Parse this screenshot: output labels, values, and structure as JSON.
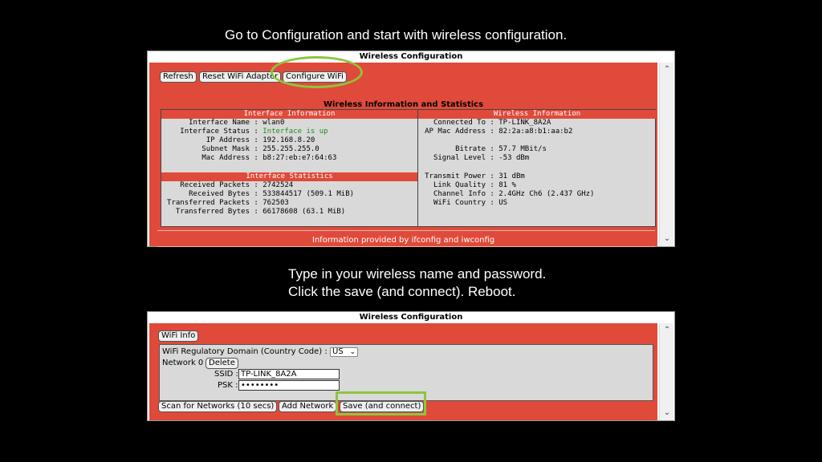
{
  "captions": {
    "top": "Go to Configuration and start with wireless configuration.",
    "mid_line1": "Type in your wireless name and password.",
    "mid_line2": "Click the save (and connect). Reboot."
  },
  "top_panel": {
    "title": "Wireless Configuration",
    "buttons": {
      "refresh": "Refresh",
      "reset": "Reset WiFi Adapter",
      "configure": "Configure WiFi"
    },
    "stats_title": "Wireless Information and Statistics",
    "interface_info": {
      "header": "Interface Information",
      "rows": [
        {
          "key": "Interface Name",
          "value": "wlan0"
        },
        {
          "key": "Interface Status",
          "value": "Interface is up"
        },
        {
          "key": "IP Address",
          "value": "192.168.8.20"
        },
        {
          "key": "Subnet Mask",
          "value": "255.255.255.0"
        },
        {
          "key": "Mac Address",
          "value": "b8:27:eb:e7:64:63"
        }
      ]
    },
    "interface_stats": {
      "header": "Interface Statistics",
      "rows": [
        {
          "key": "Received Packets",
          "value": "2742524"
        },
        {
          "key": "Received Bytes",
          "value": "533844517 (509.1 MiB)"
        },
        {
          "key": "Transferred Packets",
          "value": "762503"
        },
        {
          "key": "Transferred Bytes",
          "value": "66178608 (63.1 MiB)"
        }
      ]
    },
    "wireless_info": {
      "header": "Wireless Information",
      "rows_a": [
        {
          "key": "Connected To",
          "value": "TP-LINK_8A2A"
        },
        {
          "key": "AP Mac Address",
          "value": "82:2a:a8:b1:aa:b2"
        }
      ],
      "rows_b": [
        {
          "key": "Bitrate",
          "value": "57.7 MBit/s"
        },
        {
          "key": "Signal Level",
          "value": "-53 dBm"
        }
      ],
      "rows_c": [
        {
          "key": "Transmit Power",
          "value": "31 dBm"
        },
        {
          "key": "Link Quality",
          "value": "81 %"
        },
        {
          "key": "Channel Info",
          "value": "2.4GHz Ch6 (2.437 GHz)"
        },
        {
          "key": "WiFi Country",
          "value": "US"
        }
      ]
    },
    "footer": "Information provided by ifconfig and iwconfig"
  },
  "bottom_panel": {
    "title": "Wireless Configuration",
    "wifi_info_button": "WiFi Info",
    "regulatory_label": "WiFi Regulatory Domain (Country Code) :",
    "country_value": "US",
    "network_label": "Network 0",
    "delete_button": "Delete",
    "ssid_label": "SSID :",
    "ssid_value": "TP-LINK_8A2A",
    "psk_label": "PSK :",
    "psk_value": "••••••••",
    "scan_button": "Scan for Networks (10 secs)",
    "add_button": "Add Network",
    "save_button": "Save (and connect)"
  },
  "colors": {
    "panel_red": "#e04a3a",
    "highlight_green": "#8cc63f",
    "status_green": "#1f8f1f"
  },
  "icons": {
    "scroll_up": "chevron-up-icon",
    "scroll_down": "chevron-down-icon",
    "select_arrow": "chevron-down-icon"
  }
}
